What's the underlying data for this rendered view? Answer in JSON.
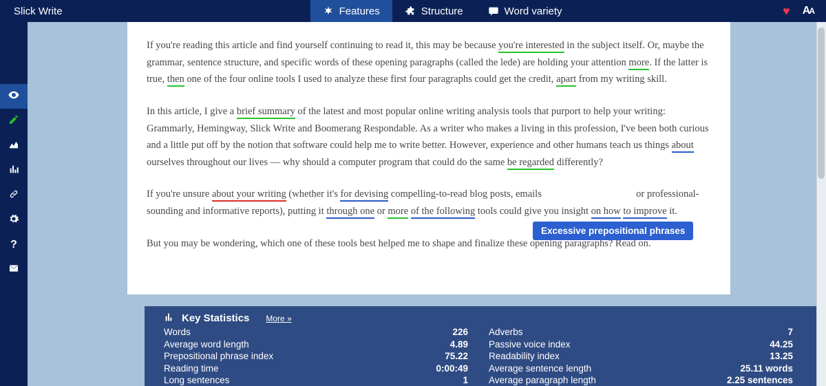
{
  "brand": "Slick Write",
  "tabs": [
    {
      "label": "Features",
      "icon": "asterisk-icon",
      "active": true
    },
    {
      "label": "Structure",
      "icon": "puzzle-icon",
      "active": false
    },
    {
      "label": "Word variety",
      "icon": "comment-icon",
      "active": false
    }
  ],
  "sidebar": [
    "eye",
    "pencil",
    "area-chart",
    "bar-chart",
    "link",
    "gear",
    "question",
    "envelope"
  ],
  "doc": {
    "p1": {
      "t1": "If you're reading this article and find yourself continuing to read it, this may be because ",
      "u1": "you're interested",
      "t2": " in the subject itself. Or, maybe the grammar, sentence structure, and specific words of these opening paragraphs (called the lede) are holding your attention ",
      "u2": "more",
      "t3": ". If the latter is true, ",
      "u3": "then",
      "t4": " one of the four online tools I used to analyze these first four paragraphs could get the credit, ",
      "u4": "apart",
      "t5": " from my writing skill."
    },
    "p2": {
      "t1": "In this article, I give a ",
      "u1": "brief summary",
      "t2": " of the latest and most popular online writing analysis tools that purport to help your writing: Grammarly, Hemingway, Slick Write and Boomerang Respondable. As a writer who makes a living in this profession, I've been both curious and a little put off by the notion that software could help me to write better. However, experience and other humans teach us things ",
      "u2": "about",
      "t3": " ourselves throughout our lives — why should a computer program that could do the same ",
      "u3": "be regarded",
      "t4": " differently?"
    },
    "p3": {
      "t1": "If you're unsure ",
      "u1": "about your writing",
      "t2": " (whether it's ",
      "u2": "for devising",
      "t3": " compelling-to-read blog posts, emails ",
      "t3b": "  or professional-sounding and informative reports), putting it ",
      "u3": "through one",
      "t4": " or ",
      "u4": "more",
      "u5": "of the following",
      "t5": " tools could give you insight ",
      "u6": "on how",
      "u7": "to improve",
      "t6": " it."
    },
    "p4": "But you may be wondering, which one of these tools best helped me to shape and finalize these opening paragraphs? Read on."
  },
  "tooltip": "Excessive prepositional phrases",
  "stats": {
    "title": "Key Statistics",
    "more": "More »",
    "left": [
      {
        "label": "Words",
        "value": "226"
      },
      {
        "label": "Average word length",
        "value": "4.89"
      },
      {
        "label": "Prepositional phrase index",
        "value": "75.22"
      },
      {
        "label": "Reading time",
        "value": "0:00:49"
      },
      {
        "label": "Long sentences",
        "value": "1"
      }
    ],
    "right": [
      {
        "label": "Adverbs",
        "value": "7"
      },
      {
        "label": "Passive voice index",
        "value": "44.25"
      },
      {
        "label": "Readability index",
        "value": "13.25"
      },
      {
        "label": "Average sentence length",
        "value": "25.11 words"
      },
      {
        "label": "Average paragraph length",
        "value": "2.25 sentences"
      }
    ]
  }
}
